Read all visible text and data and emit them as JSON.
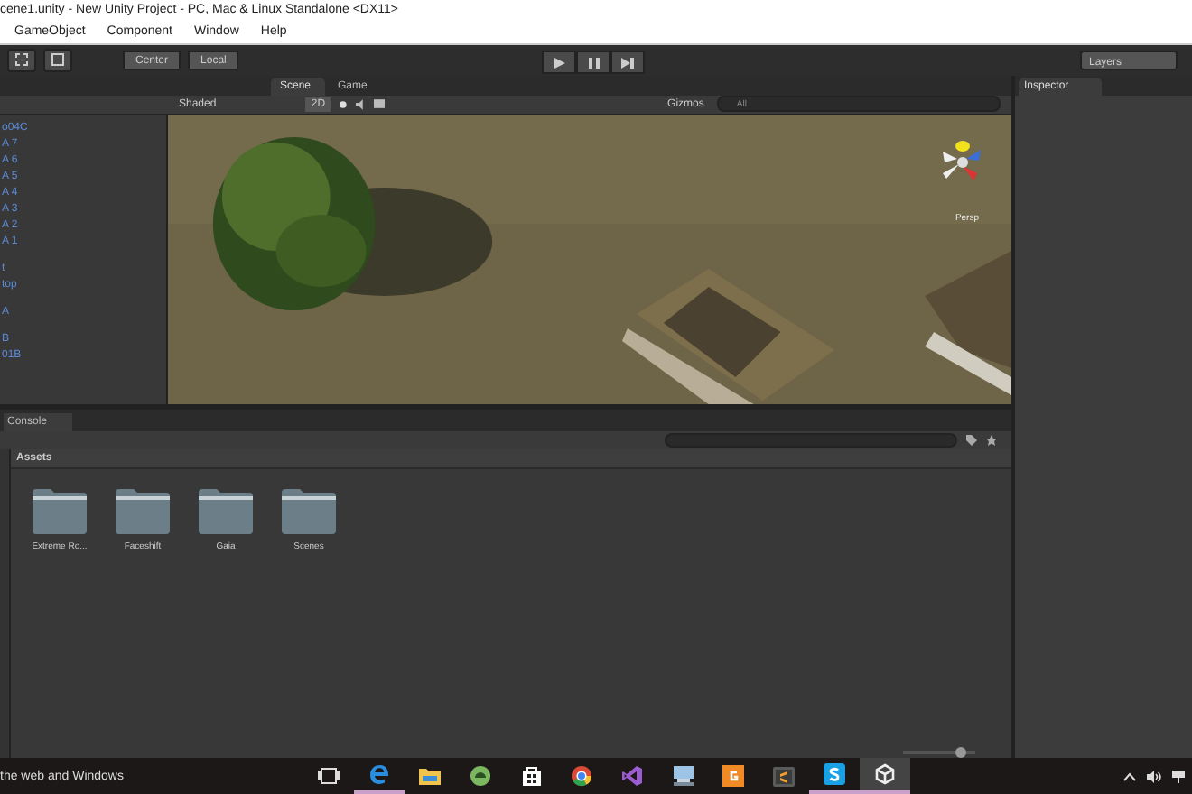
{
  "window": {
    "title": "cene1.unity - New Unity Project - PC, Mac & Linux Standalone <DX11>"
  },
  "menu": [
    "GameObject",
    "Component",
    "Window",
    "Help"
  ],
  "toolbar": {
    "pivot_buttons": [
      "Center",
      "Local"
    ],
    "layers": "Layers"
  },
  "tabs": [
    {
      "label": "Scene",
      "selected": true
    },
    {
      "label": "Game",
      "selected": false
    }
  ],
  "scene_toolbar": {
    "shading": "Shaded",
    "mode": "2D",
    "gizmos": "Gizmos",
    "search_placeholder": "All"
  },
  "scene_view": {
    "kind": "picture",
    "projection": "Persp"
  },
  "hierarchy": {
    "groups": [
      [
        "o04C",
        "A 7",
        "A 6",
        "A 5",
        "A 4",
        "A 3",
        "A 2",
        "A 1"
      ],
      [
        "t",
        "top"
      ],
      [
        "A"
      ],
      [
        "B",
        "01B"
      ]
    ]
  },
  "inspector": {
    "tab": "Inspector"
  },
  "console": {
    "tab": "Console"
  },
  "project": {
    "icon_size": {
      "level": 0.8
    },
    "breadcrumb": "Assets",
    "folders": [
      "Extreme Ro...",
      "Faceshift",
      "Gaia",
      "Scenes"
    ]
  },
  "taskbar": {
    "search_text": "the web and Windows",
    "apps": [
      {
        "kind": "taskview",
        "running": false,
        "selected": false
      },
      {
        "kind": "edge",
        "running": true,
        "selected": false
      },
      {
        "kind": "explorer",
        "running": false,
        "selected": false
      },
      {
        "kind": "android",
        "running": false,
        "selected": false
      },
      {
        "kind": "store",
        "running": false,
        "selected": false
      },
      {
        "kind": "chrome",
        "running": false,
        "selected": false
      },
      {
        "kind": "vs",
        "running": false,
        "selected": false
      },
      {
        "kind": "network",
        "running": false,
        "selected": false
      },
      {
        "kind": "orange",
        "running": false,
        "selected": false
      },
      {
        "kind": "sublime",
        "running": false,
        "selected": false
      },
      {
        "kind": "skype",
        "running": true,
        "selected": false
      },
      {
        "kind": "unity",
        "running": true,
        "selected": true
      }
    ]
  }
}
